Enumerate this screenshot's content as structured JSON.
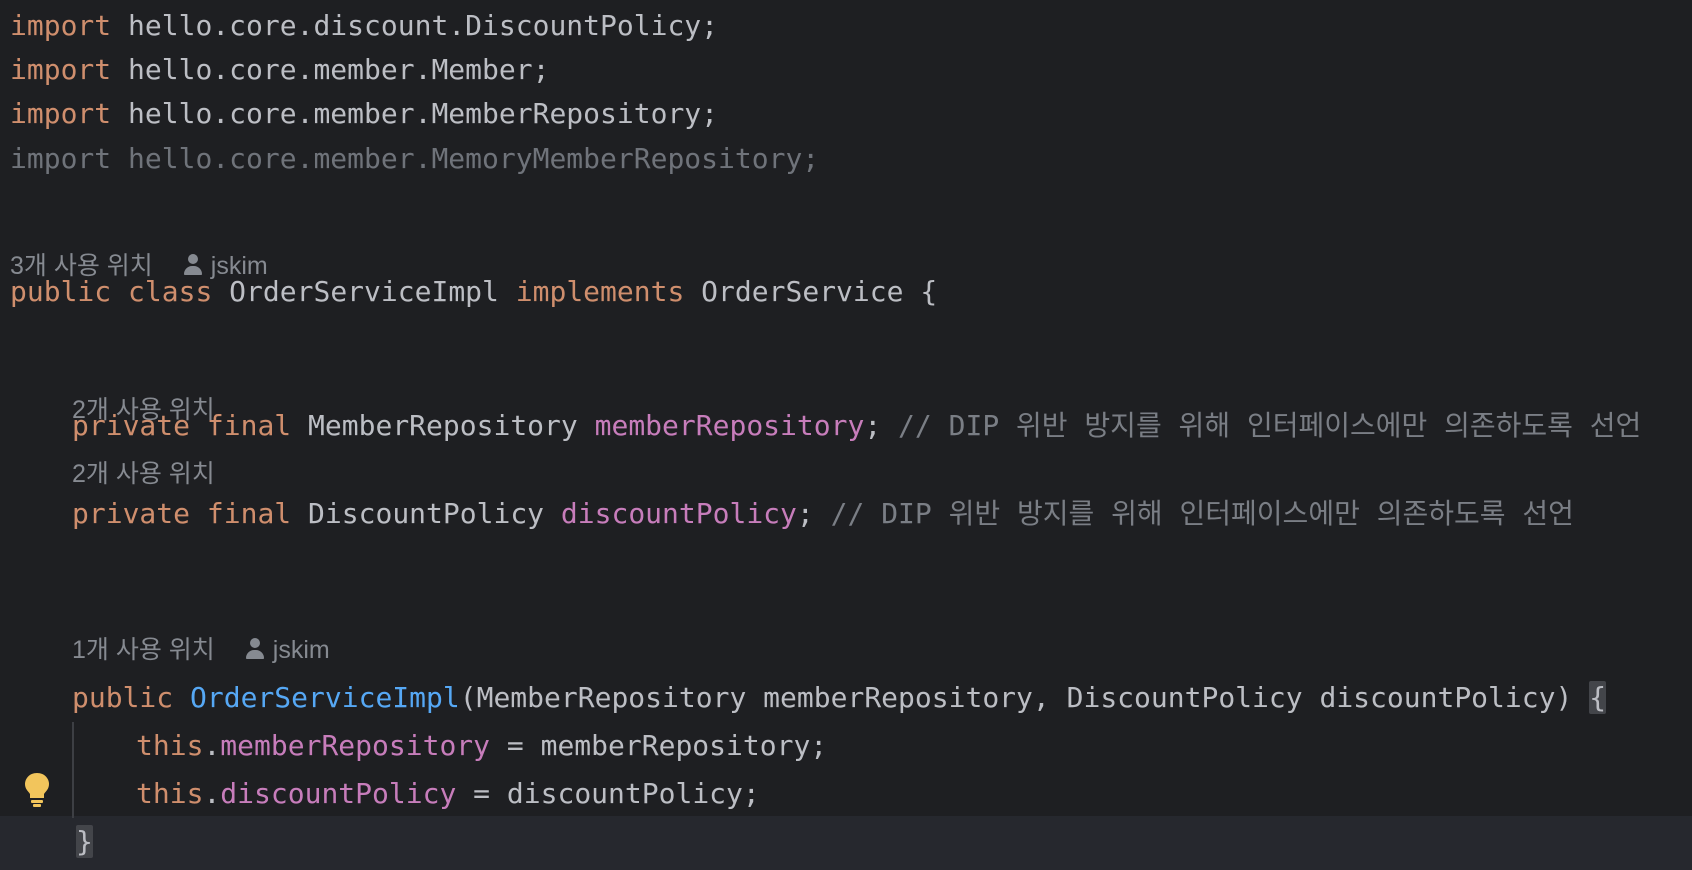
{
  "editor": {
    "language": "java",
    "colors": {
      "background": "#1e1f22",
      "keyword": "#cf8e6d",
      "field": "#c77dbb",
      "method": "#56a8f5",
      "comment": "#7a7e85",
      "text": "#bcbec4"
    },
    "imports": [
      {
        "keyword": "import",
        "path": " hello.core.discount.DiscountPolicy;"
      },
      {
        "keyword": "import",
        "path": " hello.core.member.Member;"
      },
      {
        "keyword": "import",
        "path": " hello.core.member.MemberRepository;"
      },
      {
        "keyword": "import",
        "path": " hello.core.member.MemoryMemberRepository;",
        "unused": true
      }
    ],
    "class_hint": {
      "usages": "3개 사용 위치",
      "author": "jskim"
    },
    "class_decl": {
      "public": "public",
      "class": "class",
      "name": " OrderServiceImpl ",
      "implements": "implements",
      "iface": " OrderService {"
    },
    "fields": [
      {
        "hint": "2개 사용 위치",
        "private": "private",
        "final": "final",
        "type": " MemberRepository ",
        "name": "memberRepository",
        "semi": ";",
        "comment": " // DIP 위반 방지를 위해 인터페이스에만 의존하도록 선언"
      },
      {
        "hint": "2개 사용 위치",
        "private": "private",
        "final": "final",
        "type": " DiscountPolicy ",
        "name": "discountPolicy",
        "semi": ";",
        "comment": " // DIP 위반 방지를 위해 인터페이스에만 의존하도록 선언"
      }
    ],
    "ctor_hint": {
      "usages": "1개 사용 위치",
      "author": "jskim"
    },
    "ctor": {
      "public": "public",
      "name": "OrderServiceImpl",
      "params": "(MemberRepository memberRepository, DiscountPolicy discountPolicy) ",
      "open_brace": "{"
    },
    "body": [
      {
        "this": "this",
        "dot": ".",
        "field": "memberRepository",
        "rest": " = memberRepository;"
      },
      {
        "this": "this",
        "dot": ".",
        "field": "discountPolicy",
        "rest": " = discountPolicy;"
      }
    ],
    "close_brace": "}",
    "gutter_icon": "lightbulb-icon"
  }
}
